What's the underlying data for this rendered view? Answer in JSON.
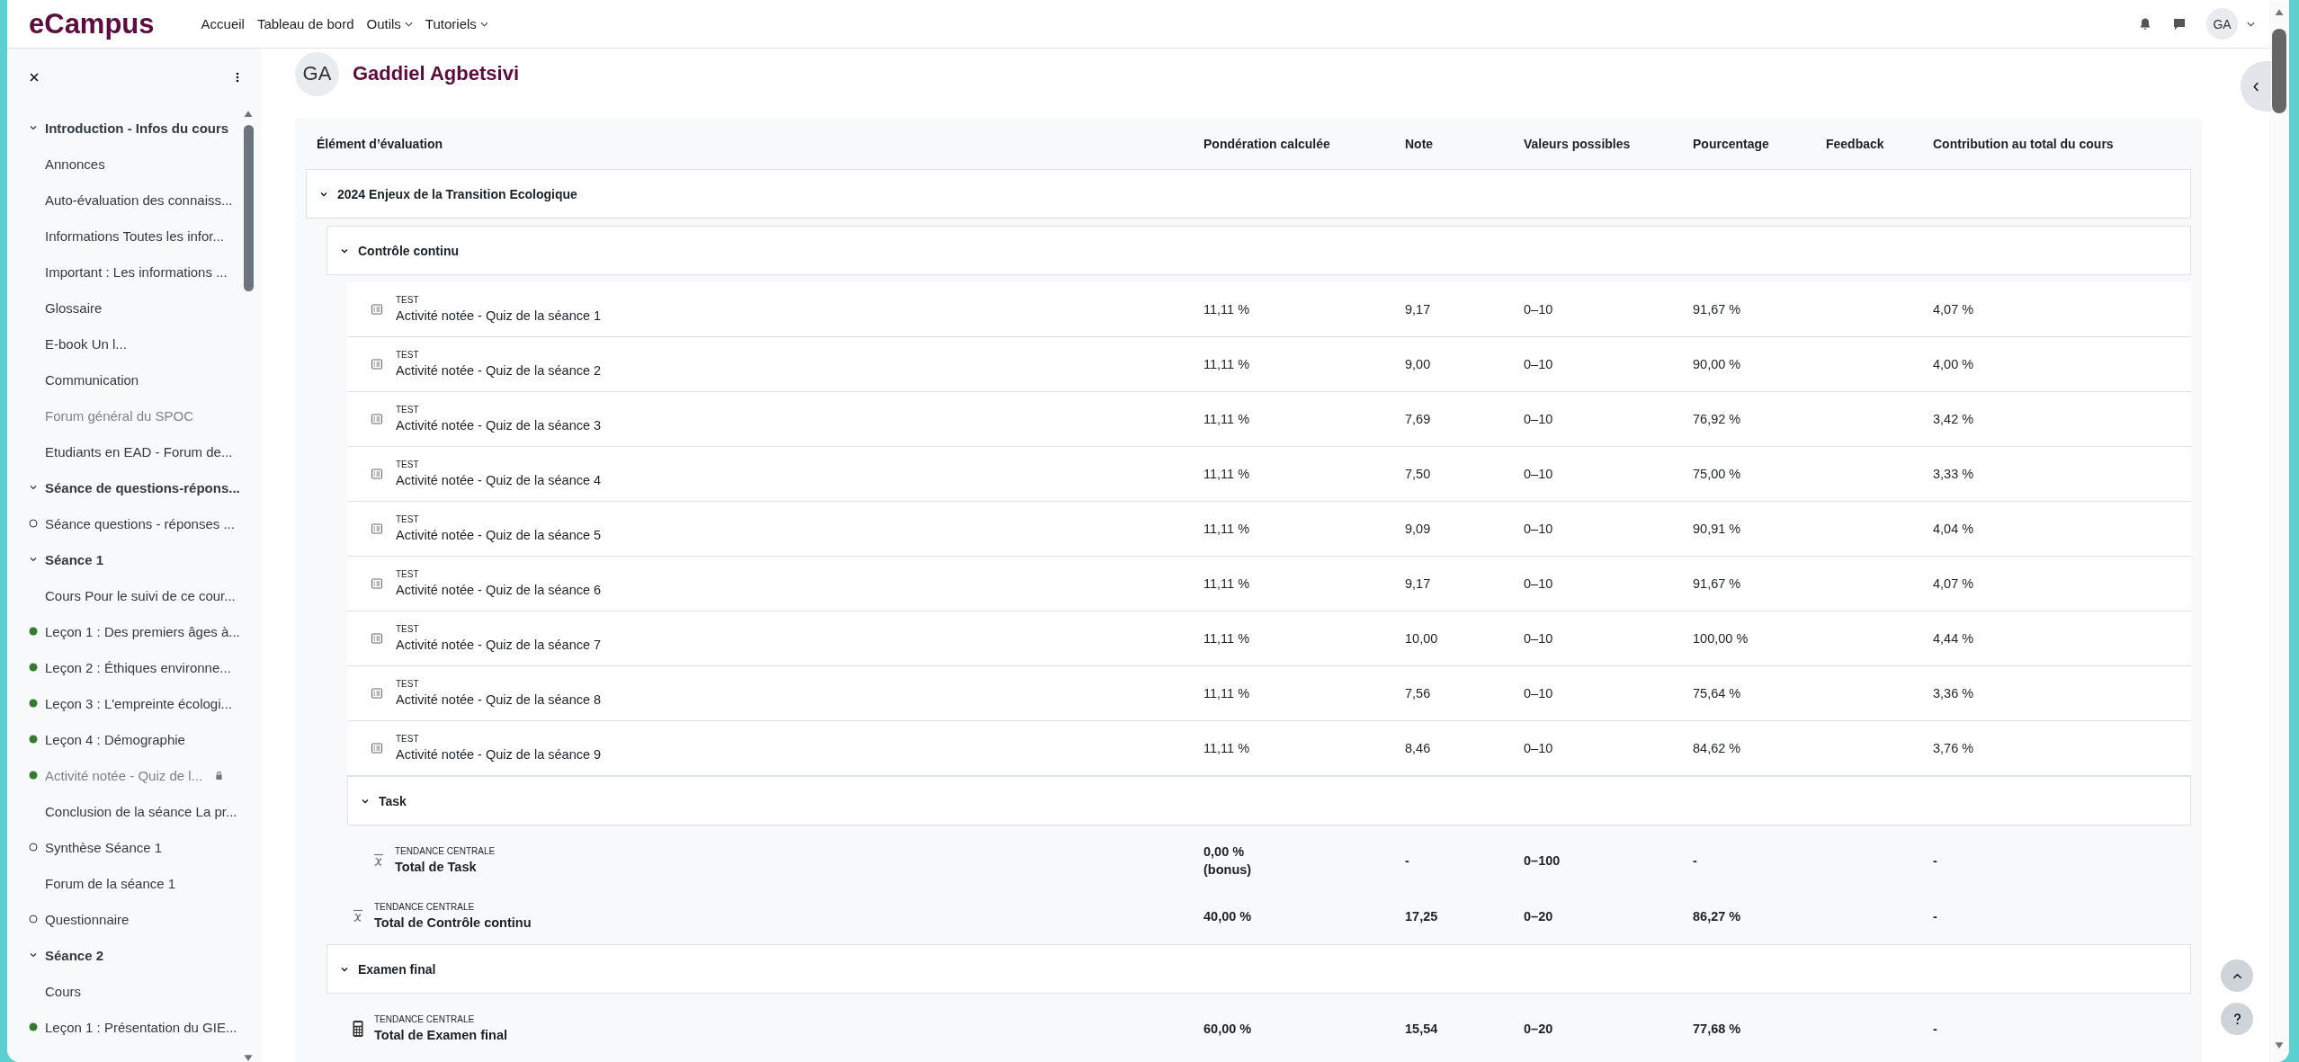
{
  "nav": {
    "logo": "eCampus",
    "links": [
      {
        "label": "Accueil",
        "dropdown": false
      },
      {
        "label": "Tableau de bord",
        "dropdown": false
      },
      {
        "label": "Outils",
        "dropdown": true
      },
      {
        "label": "Tutoriels",
        "dropdown": true
      }
    ],
    "avatar": "GA"
  },
  "sidebar": {
    "sections": [
      {
        "title": "Introduction - Infos du cours",
        "expanded": true,
        "items": [
          {
            "label": "Annonces",
            "dimmed": false,
            "locked": false
          },
          {
            "label": "Auto-évaluation des connaiss...",
            "dimmed": false,
            "locked": false
          },
          {
            "label": "Informations Toutes les infor...",
            "dimmed": false,
            "locked": false
          },
          {
            "label": "Important : Les informations ...",
            "dimmed": false,
            "locked": false
          },
          {
            "label": "Glossaire",
            "dimmed": false,
            "locked": false
          },
          {
            "label": "E-book Un l...",
            "dimmed": false,
            "locked": false
          },
          {
            "label": "Communication",
            "dimmed": false,
            "locked": false
          },
          {
            "label": "Forum général du SPOC",
            "dimmed": true,
            "locked": false
          },
          {
            "label": "Etudiants en EAD - Forum de...",
            "dimmed": false,
            "locked": false
          }
        ]
      },
      {
        "title": "Séance de questions-répons...",
        "expanded": true,
        "items": [
          {
            "label": "Séance questions - réponses ...",
            "completed": false,
            "dimmed": false,
            "locked": false
          }
        ]
      },
      {
        "title": "Séance 1",
        "expanded": true,
        "items": [
          {
            "label": "Cours Pour le suivi de ce cour...",
            "dimmed": false,
            "locked": false
          },
          {
            "label": "Leçon 1 : Des premiers âges à...",
            "completed": true,
            "dimmed": false,
            "locked": false
          },
          {
            "label": "Leçon 2 : Éthiques environne...",
            "completed": true,
            "dimmed": false,
            "locked": false
          },
          {
            "label": "Leçon 3 : L'empreinte écologi...",
            "completed": true,
            "dimmed": false,
            "locked": false
          },
          {
            "label": "Leçon 4 : Démographie",
            "completed": true,
            "dimmed": false,
            "locked": false
          },
          {
            "label": "Activité notée - Quiz de l...",
            "completed": true,
            "dimmed": true,
            "locked": true
          },
          {
            "label": "Conclusion de la séance La pr...",
            "dimmed": false,
            "locked": false
          },
          {
            "label": "Synthèse Séance 1",
            "completed": false,
            "dimmed": false,
            "locked": false
          },
          {
            "label": "Forum de la séance 1",
            "dimmed": false,
            "locked": false
          },
          {
            "label": "Questionnaire",
            "completed": false,
            "dimmed": false,
            "locked": false
          }
        ]
      },
      {
        "title": "Séance 2",
        "expanded": true,
        "items": [
          {
            "label": "Cours",
            "dimmed": false,
            "locked": false
          },
          {
            "label": "Leçon 1 : Présentation du GIE...",
            "completed": true,
            "dimmed": false,
            "locked": false
          }
        ]
      }
    ]
  },
  "user": {
    "initials": "GA",
    "name": "Gaddiel Agbetsivi"
  },
  "report": {
    "columns": [
      "Élément d’évaluation",
      "Pondération calculée",
      "Note",
      "Valeurs possibles",
      "Pourcentage",
      "Feedback",
      "Contribution au total du cours"
    ],
    "rows": [
      {
        "kind": "category",
        "label": "2024 Enjeux de la Transition Ecologique",
        "expanded": true,
        "children": [
          {
            "kind": "category",
            "label": "Contrôle continu",
            "expanded": true,
            "children": [
              {
                "kind": "item",
                "type": "TEST",
                "label": "Activité notée - Quiz de la séance 1",
                "weight": "11,11 %",
                "grade": "9,17",
                "range": "0–10",
                "percentage": "91,67 %",
                "contribution": "4,07 %"
              },
              {
                "kind": "item",
                "type": "TEST",
                "label": "Activité notée - Quiz de la séance 2",
                "weight": "11,11 %",
                "grade": "9,00",
                "range": "0–10",
                "percentage": "90,00 %",
                "contribution": "4,00 %"
              },
              {
                "kind": "item",
                "type": "TEST",
                "label": "Activité notée - Quiz de la séance 3",
                "weight": "11,11 %",
                "grade": "7,69",
                "range": "0–10",
                "percentage": "76,92 %",
                "contribution": "3,42 %"
              },
              {
                "kind": "item",
                "type": "TEST",
                "label": "Activité notée - Quiz de la séance 4",
                "weight": "11,11 %",
                "grade": "7,50",
                "range": "0–10",
                "percentage": "75,00 %",
                "contribution": "3,33 %"
              },
              {
                "kind": "item",
                "type": "TEST",
                "label": "Activité notée - Quiz de la séance 5",
                "weight": "11,11 %",
                "grade": "9,09",
                "range": "0–10",
                "percentage": "90,91 %",
                "contribution": "4,04 %"
              },
              {
                "kind": "item",
                "type": "TEST",
                "label": "Activité notée - Quiz de la séance 6",
                "weight": "11,11 %",
                "grade": "9,17",
                "range": "0–10",
                "percentage": "91,67 %",
                "contribution": "4,07 %"
              },
              {
                "kind": "item",
                "type": "TEST",
                "label": "Activité notée - Quiz de la séance 7",
                "weight": "11,11 %",
                "grade": "10,00",
                "range": "0–10",
                "percentage": "100,00 %",
                "contribution": "4,44 %"
              },
              {
                "kind": "item",
                "type": "TEST",
                "label": "Activité notée - Quiz de la séance 8",
                "weight": "11,11 %",
                "grade": "7,56",
                "range": "0–10",
                "percentage": "75,64 %",
                "contribution": "3,36 %"
              },
              {
                "kind": "item",
                "type": "TEST",
                "label": "Activité notée - Quiz de la séance 9",
                "weight": "11,11 %",
                "grade": "8,46",
                "range": "0–10",
                "percentage": "84,62 %",
                "contribution": "3,76 %"
              },
              {
                "kind": "category",
                "label": "Task",
                "expanded": true,
                "children": [
                  {
                    "kind": "mean_total",
                    "type": "TENDANCE CENTRALE",
                    "label": "Total de Task",
                    "weight": "0,00 %",
                    "weight_note": "(bonus)",
                    "grade": "-",
                    "range": "0–100",
                    "percentage": "-",
                    "contribution": "-"
                  }
                ]
              },
              {
                "kind": "mean_total",
                "type": "TENDANCE CENTRALE",
                "label": "Total de Contrôle continu",
                "weight": "40,00 %",
                "grade": "17,25",
                "range": "0–20",
                "percentage": "86,27 %",
                "contribution": "-"
              }
            ]
          },
          {
            "kind": "category",
            "label": "Examen final",
            "expanded": true,
            "children": [
              {
                "kind": "calculated_total",
                "type": "TENDANCE CENTRALE",
                "label": "Total de Examen final",
                "weight": "60,00 %",
                "grade": "15,54",
                "range": "0–20",
                "percentage": "77,68 %",
                "contribution": "-"
              }
            ]
          }
        ]
      }
    ]
  }
}
